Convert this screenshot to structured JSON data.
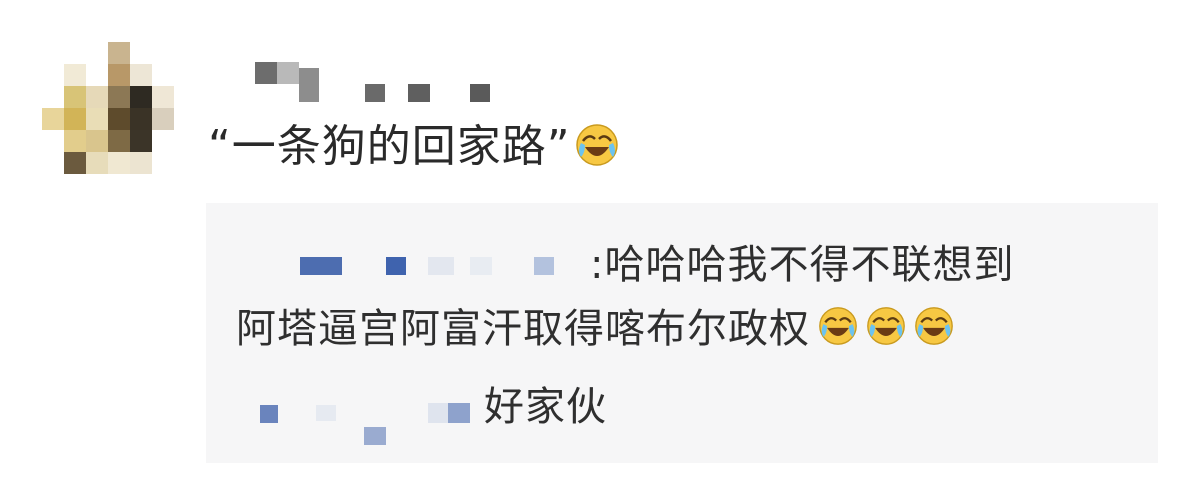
{
  "comment": {
    "text": "“一条狗的回家路”",
    "emoji": "laughing-crying-emoji"
  },
  "replies": [
    {
      "separator": ":",
      "text_line1": "哈哈哈我不得不联想到",
      "text_line2": "阿塔逼宫阿富汗取得喀布尔政权",
      "emoji_count": 3
    },
    {
      "text": "好家伙"
    }
  ],
  "colors": {
    "reply_background": "#f6f6f7",
    "pixelated_username": "#4a6fb5",
    "emoji_yellow": "#f7c843"
  }
}
